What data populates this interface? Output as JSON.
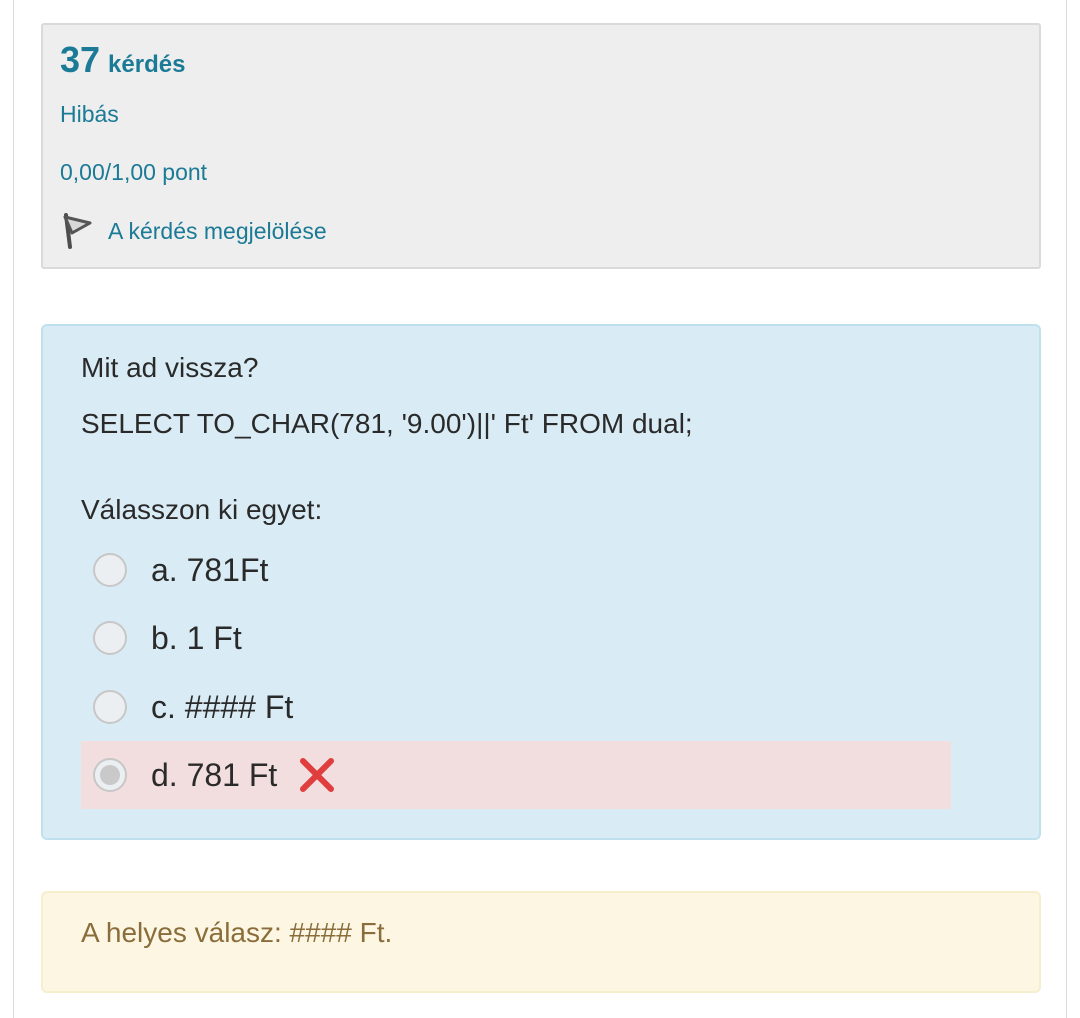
{
  "info": {
    "question_number": "37",
    "question_word": "kérdés",
    "state": "Hibás",
    "grade": "0,00/1,00 pont",
    "flag_label": "A kérdés megjelölése",
    "flag_icon": "flag-icon"
  },
  "question": {
    "text_line_1": "Mit ad vissza?",
    "text_line_2": "SELECT TO_CHAR(781, '9.00')||' Ft' FROM dual;",
    "prompt": "Válasszon ki egyet:",
    "answers": [
      {
        "label": "a. 781Ft",
        "selected": false,
        "status": ""
      },
      {
        "label": "b. 1 Ft",
        "selected": false,
        "status": ""
      },
      {
        "label": "c. #### Ft",
        "selected": false,
        "status": ""
      },
      {
        "label": "d. 781 Ft",
        "selected": true,
        "status": "incorrect",
        "status_icon": "incorrect-x-icon"
      }
    ]
  },
  "feedback": {
    "right_answer": "A helyes válasz: #### Ft."
  },
  "colors": {
    "link": "#1b7a96",
    "info_bg": "#eeeeee",
    "question_bg": "#d9ecf5",
    "incorrect_bg": "#f2dede",
    "incorrect_icon": "#e03e3e",
    "feedback_bg": "#fcf6e2",
    "feedback_text": "#8a6d3b"
  }
}
